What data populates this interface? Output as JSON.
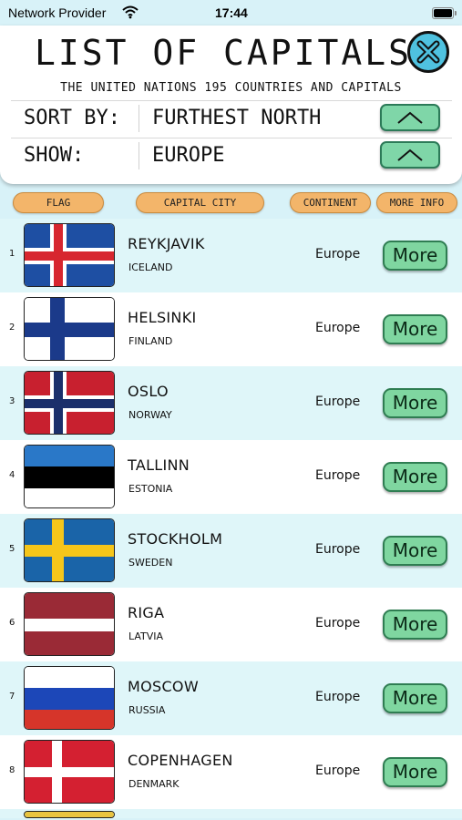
{
  "status_bar": {
    "carrier": "Network Provider",
    "time": "17:44"
  },
  "header": {
    "title": "LIST OF CAPITALS",
    "subtitle": "THE UNITED NATIONS 195 COUNTRIES AND CAPITALS",
    "sort_label": "SORT BY:",
    "sort_value": "FURTHEST NORTH",
    "show_label": "SHOW:",
    "show_value": "EUROPE"
  },
  "columns": {
    "flag": "FLAG",
    "capital": "CAPITAL CITY",
    "continent": "CONTINENT",
    "more": "MORE INFO"
  },
  "more_label": "More",
  "rows": [
    {
      "num": "1",
      "city": "REYKJAVIK",
      "country": "ICELAND",
      "continent": "Europe"
    },
    {
      "num": "2",
      "city": "HELSINKI",
      "country": "FINLAND",
      "continent": "Europe"
    },
    {
      "num": "3",
      "city": "OSLO",
      "country": "NORWAY",
      "continent": "Europe"
    },
    {
      "num": "4",
      "city": "TALLINN",
      "country": "ESTONIA",
      "continent": "Europe"
    },
    {
      "num": "5",
      "city": "STOCKHOLM",
      "country": "SWEDEN",
      "continent": "Europe"
    },
    {
      "num": "6",
      "city": "RIGA",
      "country": "LATVIA",
      "continent": "Europe"
    },
    {
      "num": "7",
      "city": "MOSCOW",
      "country": "RUSSIA",
      "continent": "Europe"
    },
    {
      "num": "8",
      "city": "COPENHAGEN",
      "country": "DENMARK",
      "continent": "Europe"
    }
  ],
  "colors": {
    "row_alt": "#dff6f9",
    "button_green": "#7fd6a0",
    "header_pill": "#f3b56a",
    "close_blue": "#4fc2e0"
  }
}
